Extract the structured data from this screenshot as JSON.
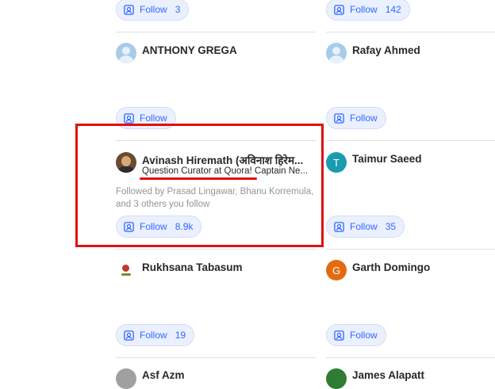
{
  "colors": {
    "accent": "#2e69ff",
    "highlight": "#e01010"
  },
  "cards": {
    "top_left_follow": {
      "label": "Follow",
      "count": "3"
    },
    "top_right_follow": {
      "label": "Follow",
      "count": "142"
    },
    "anthony": {
      "name": "ANTHONY GREGA",
      "follow_label": "Follow",
      "avatar_icon": "default-user-icon"
    },
    "rafay": {
      "name": "Rafay Ahmed",
      "follow_label": "Follow",
      "avatar_icon": "default-user-icon"
    },
    "avinash": {
      "name": "Avinash Hiremath (अविनाश हिरेम...",
      "tagline": "Question Curator at Quora! Captain Ne...",
      "followed_by": "Followed by Prasad Lingawar, Bhanu Korremula, and 3 others you follow",
      "follow_label": "Follow",
      "follow_count": "8.9k"
    },
    "taimur": {
      "name": "Taimur Saeed",
      "initial": "T",
      "follow_label": "Follow",
      "follow_count": "35"
    },
    "rukhsana": {
      "name": "Rukhsana Tabasum",
      "follow_label": "Follow",
      "follow_count": "19"
    },
    "garth": {
      "name": "Garth Domingo",
      "initial": "G",
      "follow_label": "Follow"
    },
    "bottom_left": {
      "name": "Asf Azm"
    },
    "bottom_right": {
      "name": "James Alapatt"
    }
  }
}
